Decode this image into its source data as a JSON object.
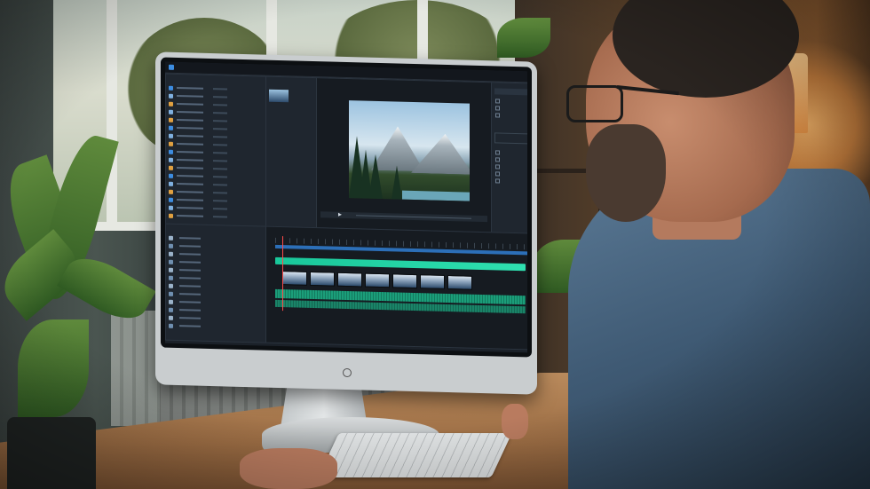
{
  "scene": {
    "description_colors": {
      "wall_warm": "#8a5a30",
      "screen_bg": "#1b2129",
      "accent_clip": "#19c79a",
      "app_icon": "#3c8ce0"
    }
  },
  "app": {
    "title": "",
    "viewer_label": "",
    "timeline_label": "",
    "browser_items": [
      {
        "icon_color": "#3c8ce0"
      },
      {
        "icon_color": "#7fb0e0"
      },
      {
        "icon_color": "#e0a040"
      },
      {
        "icon_color": "#7fb0e0"
      },
      {
        "icon_color": "#e0a040"
      },
      {
        "icon_color": "#3c8ce0"
      },
      {
        "icon_color": "#7fb0e0"
      },
      {
        "icon_color": "#e0a040"
      },
      {
        "icon_color": "#3c8ce0"
      },
      {
        "icon_color": "#7fb0e0"
      },
      {
        "icon_color": "#e0a040"
      },
      {
        "icon_color": "#3c8ce0"
      },
      {
        "icon_color": "#7fb0e0"
      },
      {
        "icon_color": "#e0a040"
      },
      {
        "icon_color": "#3c8ce0"
      },
      {
        "icon_color": "#7fb0e0"
      },
      {
        "icon_color": "#e0a040"
      }
    ],
    "timeline_thumbnails": 7,
    "icons": [
      "play-icon",
      "app-logo-icon",
      "checkbox-icon"
    ]
  }
}
